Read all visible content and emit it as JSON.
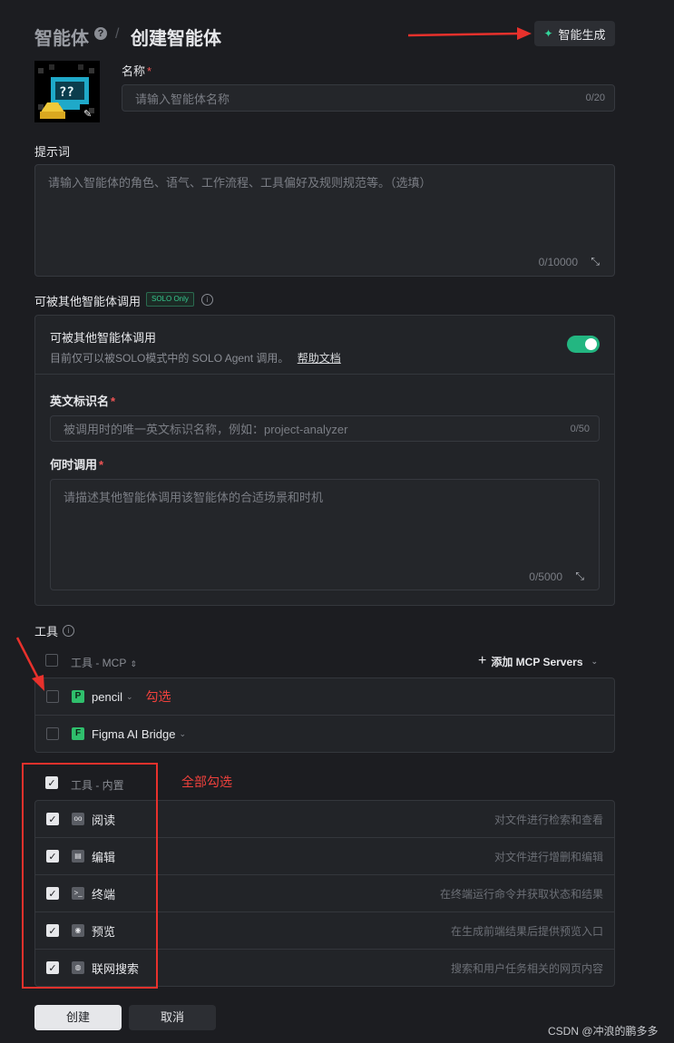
{
  "header": {
    "breadcrumb_root": "智能体",
    "breadcrumb_separator": "/",
    "page_title": "创建智能体",
    "generate_button": "智能生成"
  },
  "name_field": {
    "label": "名称",
    "placeholder": "请输入智能体名称",
    "counter": "0/20"
  },
  "prompt_field": {
    "label": "提示词",
    "placeholder": "请输入智能体的角色、语气、工作流程、工具偏好及规则规范等。（选填）",
    "counter": "0/10000"
  },
  "callable_section": {
    "label": "可被其他智能体调用",
    "badge": "SOLO Only",
    "toggle_title": "可被其他智能体调用",
    "toggle_on": true,
    "description": "目前仅可以被SOLO模式中的 SOLO Agent 调用。",
    "help_link": "帮助文档",
    "english_id_label": "英文标识名",
    "english_id_placeholder": "被调用时的唯一英文标识名称，例如：project-analyzer",
    "english_id_counter": "0/50",
    "when_label": "何时调用",
    "when_placeholder": "请描述其他智能体调用该智能体的合适场景和时机",
    "when_counter": "0/5000"
  },
  "tools": {
    "label": "工具",
    "mcp_header": "工具 - MCP",
    "add_mcp": "添加 MCP Servers",
    "mcp_items": [
      {
        "name": "pencil",
        "tag": "P",
        "checked": false
      },
      {
        "name": "Figma AI Bridge",
        "tag": "F",
        "checked": false
      }
    ],
    "builtin_header": "工具 - 内置",
    "builtin_items": [
      {
        "name": "阅读",
        "description": "对文件进行检索和查看",
        "icon": "glasses-icon",
        "checked": true
      },
      {
        "name": "编辑",
        "description": "对文件进行增删和编辑",
        "icon": "file-edit-icon",
        "checked": true
      },
      {
        "name": "终端",
        "description": "在终端运行命令并获取状态和结果",
        "icon": "terminal-icon",
        "checked": true
      },
      {
        "name": "预览",
        "description": "在生成前端结果后提供预览入口",
        "icon": "eye-icon",
        "checked": true
      },
      {
        "name": "联网搜索",
        "description": "搜索和用户任务相关的网页内容",
        "icon": "globe-icon",
        "checked": true
      }
    ]
  },
  "annotations": {
    "check_one": "勾选",
    "check_all": "全部勾选"
  },
  "footer": {
    "create_button": "创建",
    "cancel_button": "取消"
  },
  "watermark": "CSDN @冲浪的鹏多多",
  "colors": {
    "background": "#1c1d21",
    "accent_green": "#23b681",
    "annotation_red": "#e8312c"
  }
}
